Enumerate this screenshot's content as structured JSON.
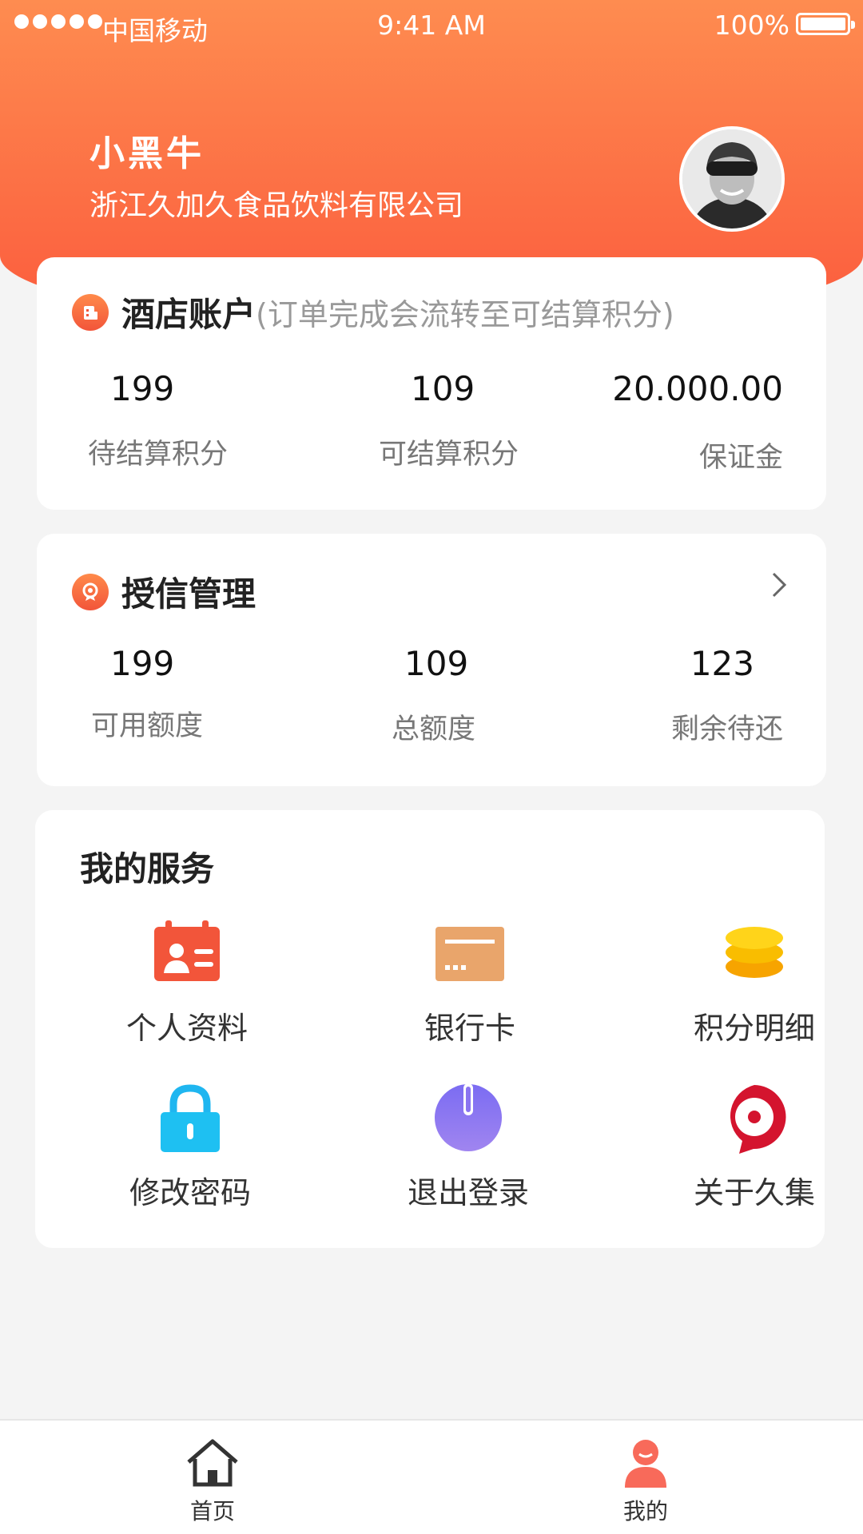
{
  "status_bar": {
    "carrier": "中国移动",
    "time": "9:41 AM",
    "battery": "100%"
  },
  "profile": {
    "name": "小黑牛",
    "company": "浙江久加久食品饮料有限公司"
  },
  "hotel_account": {
    "title": "酒店账户",
    "subtitle": "(订单完成会流转至可结算积分)",
    "stats": [
      {
        "value": "199",
        "label": "待结算积分"
      },
      {
        "value": "109",
        "label": "可结算积分"
      },
      {
        "value": "20.000.00",
        "label": "保证金"
      }
    ]
  },
  "credit": {
    "title": "授信管理",
    "stats": [
      {
        "value": "199",
        "label": "可用额度"
      },
      {
        "value": "109",
        "label": "总额度"
      },
      {
        "value": "123",
        "label": "剩余待还"
      }
    ]
  },
  "services": {
    "title": "我的服务",
    "items": [
      {
        "label": "个人资料",
        "icon": "id-card-icon"
      },
      {
        "label": "银行卡",
        "icon": "bank-card-icon"
      },
      {
        "label": "积分明细",
        "icon": "coins-icon"
      },
      {
        "label": "修改密码",
        "icon": "lock-icon"
      },
      {
        "label": "退出登录",
        "icon": "power-icon"
      },
      {
        "label": "关于久集",
        "icon": "location-pin-icon"
      }
    ]
  },
  "tabbar": {
    "tabs": [
      {
        "label": "首页",
        "icon": "home-icon"
      },
      {
        "label": "我的",
        "icon": "user-icon",
        "active": true
      }
    ]
  },
  "colors": {
    "header_gradient_start": "#fe8c50",
    "header_gradient_end": "#fb5b3d",
    "accent": "#f2553a",
    "page_bg": "#f4f4f4"
  }
}
